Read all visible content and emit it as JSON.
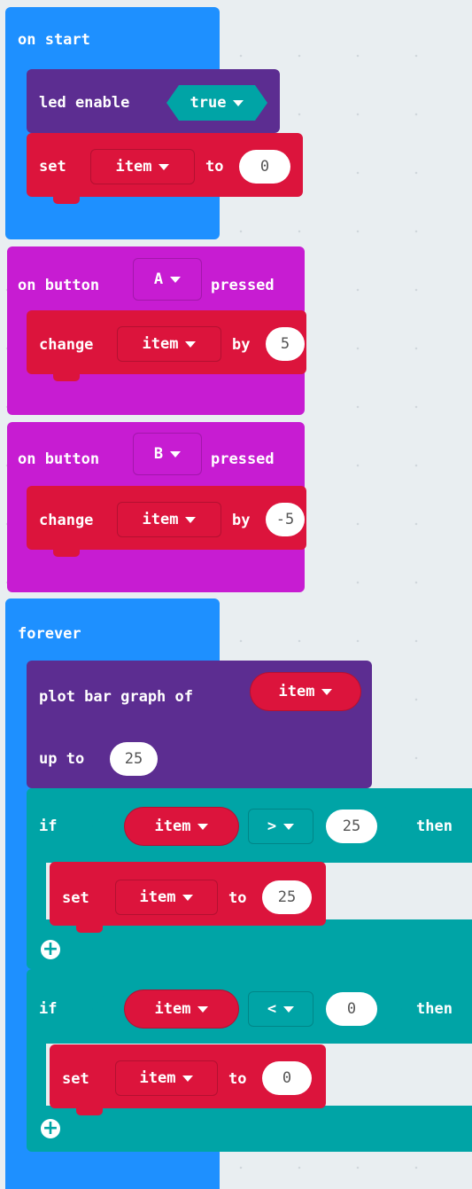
{
  "colors": {
    "events_blue": "#1e90ff",
    "led_purple": "#5c2d91",
    "variables_red": "#dc143c",
    "input_magenta": "#c71cd2",
    "logic_teal": "#00a4a6",
    "workspace": "#e9eef1"
  },
  "on_start": {
    "label": "on start",
    "led_enable": {
      "label": "led enable",
      "value": "true"
    },
    "set": {
      "label": "set",
      "variable": "item",
      "to": "to",
      "value": "0"
    }
  },
  "button_a": {
    "prefix": "on button",
    "button": "A",
    "suffix": "pressed",
    "change": {
      "label": "change",
      "variable": "item",
      "by": "by",
      "value": "5"
    }
  },
  "button_b": {
    "prefix": "on button",
    "button": "B",
    "suffix": "pressed",
    "change": {
      "label": "change",
      "variable": "item",
      "by": "by",
      "value": "-5"
    }
  },
  "forever": {
    "label": "forever",
    "plot": {
      "label": "plot bar graph of",
      "variable": "item",
      "up_to": "up to",
      "value": "25"
    },
    "if1": {
      "if": "if",
      "variable": "item",
      "operator": ">",
      "value": "25",
      "then": "then",
      "set": {
        "label": "set",
        "variable": "item",
        "to": "to",
        "value": "25"
      }
    },
    "if2": {
      "if": "if",
      "variable": "item",
      "operator": "<",
      "value": "0",
      "then": "then",
      "set": {
        "label": "set",
        "variable": "item",
        "to": "to",
        "value": "0"
      }
    }
  },
  "icons": {
    "add": "plus-circle-icon",
    "dropdown": "caret-down-icon"
  }
}
